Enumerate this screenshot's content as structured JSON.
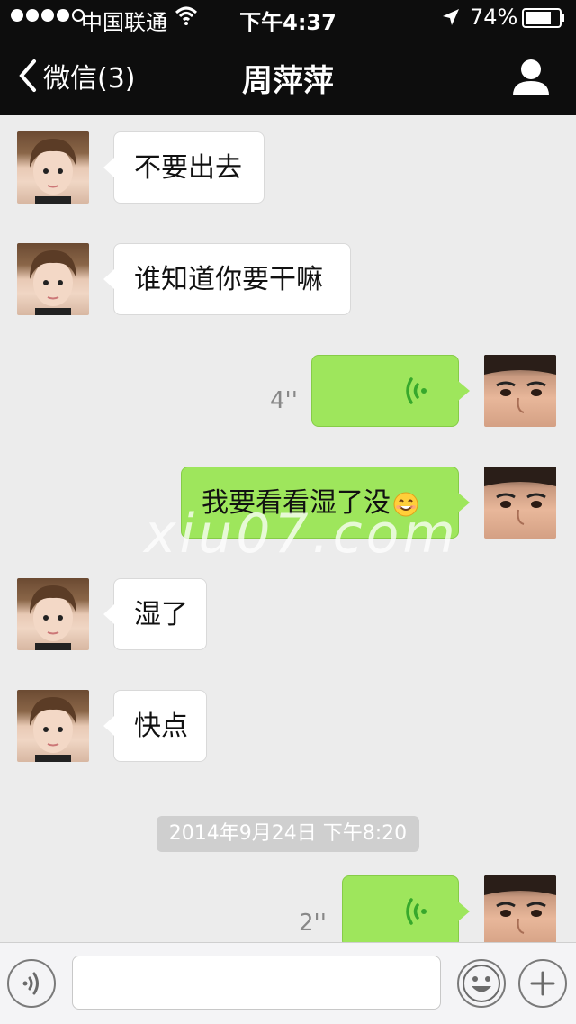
{
  "status": {
    "carrier": "中国联通",
    "time": "下午4:37",
    "battery": "74%"
  },
  "nav": {
    "back_label": "微信(3)",
    "title": "周萍萍"
  },
  "messages": [
    {
      "side": "in",
      "type": "text",
      "text": "不要出去"
    },
    {
      "side": "in",
      "type": "text",
      "text": "谁知道你要干嘛"
    },
    {
      "side": "out",
      "type": "voice",
      "duration": "4''"
    },
    {
      "side": "out",
      "type": "text",
      "text": "我要看看湿了没"
    },
    {
      "side": "in",
      "type": "text",
      "text": "湿了"
    },
    {
      "side": "in",
      "type": "text",
      "text": "快点"
    },
    {
      "side": "out",
      "type": "voice",
      "duration": "2''"
    }
  ],
  "timestamp": "2014年9月24日  下午8:20",
  "watermark": "xiu07.com",
  "input": {
    "value": "",
    "placeholder": ""
  },
  "icons": {
    "back": "chevron-left-icon",
    "profile": "person-icon",
    "voice": "voice-wave-icon",
    "emoji": "smiley-icon",
    "more": "plus-icon"
  },
  "colors": {
    "bar_bg": "#0d0d0d",
    "chat_bg": "#ececec",
    "bubble_out": "#9ee65c",
    "bubble_in": "#ffffff",
    "voice_wave": "#37a82c"
  }
}
